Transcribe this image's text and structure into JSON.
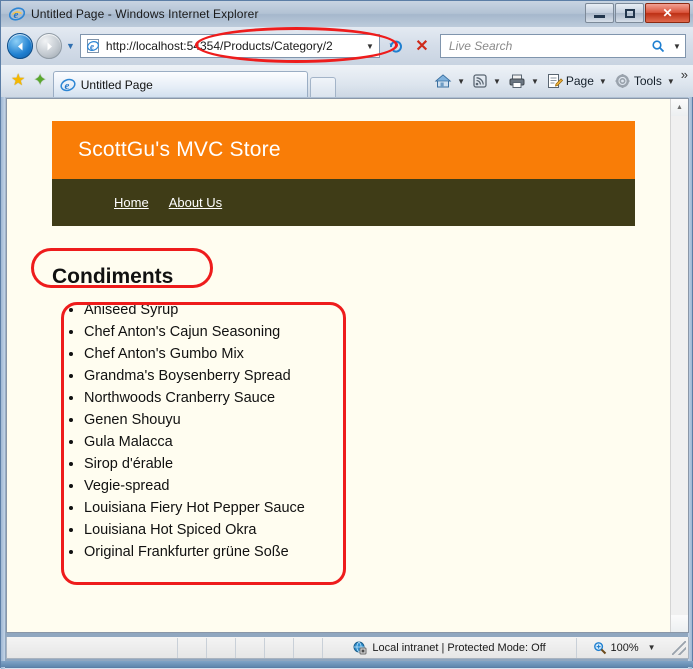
{
  "window": {
    "title": "Untitled Page - Windows Internet Explorer",
    "icon": "ie-logo-icon",
    "minimize_label": "",
    "maximize_label": "",
    "close_label": "✕"
  },
  "navbar": {
    "back_glyph": "◀",
    "forward_glyph": "▶",
    "recent_caret": "▼",
    "address": {
      "url": "http://localhost:54354/Products/Category/2",
      "dropdown_caret": "▼",
      "favicon": "page-icon"
    },
    "refresh_glyph": "↻",
    "stop_glyph": "✕",
    "search": {
      "placeholder": "Live Search",
      "icon": "search-icon",
      "dropdown_caret": "▼"
    }
  },
  "tabrow": {
    "favorites_star": "★",
    "add_favorites_star": "✦",
    "tab_label": "Untitled Page",
    "new_tab_label": "",
    "commands": [
      {
        "name": "home",
        "label": "",
        "icon": "home-icon",
        "caret": "▼"
      },
      {
        "name": "feeds",
        "label": "",
        "icon": "rss-feed-icon",
        "caret": "▼"
      },
      {
        "name": "print",
        "label": "",
        "icon": "printer-icon",
        "caret": "▼"
      },
      {
        "name": "page",
        "label": "Page",
        "icon": "page-menu-icon",
        "caret": "▼"
      },
      {
        "name": "tools",
        "label": "Tools",
        "icon": "gear-icon",
        "caret": "▼"
      }
    ],
    "overflow_glyph": "»"
  },
  "page": {
    "site_title": "ScottGu's MVC Store",
    "nav_links": [
      {
        "label": "Home"
      },
      {
        "label": "About Us"
      }
    ],
    "category_heading": "Condiments",
    "products": [
      "Aniseed Syrup",
      "Chef Anton's Cajun Seasoning",
      "Chef Anton's Gumbo Mix",
      "Grandma's Boysenberry Spread",
      "Northwoods Cranberry Sauce",
      "Genen Shouyu",
      "Gula Malacca",
      "Sirop d'érable",
      "Vegie-spread",
      "Louisiana Fiery Hot Pepper Sauce",
      "Louisiana Hot Spiced Okra",
      "Original Frankfurter grüne Soße"
    ]
  },
  "statusbar": {
    "zone_text": "Local intranet | Protected Mode: Off",
    "zone_icon": "internet-zone-icon",
    "zoom_level": "100%",
    "zoom_icon": "zoom-magnifier-icon",
    "zoom_caret": "▼"
  },
  "scrollbar": {
    "up_glyph": "▲",
    "down_glyph": "▼"
  },
  "colors": {
    "banner_orange": "#f97d07",
    "nav_olive": "#3f3c17",
    "page_background": "#fffdf0",
    "annotation_red": "#ee1c1c"
  }
}
